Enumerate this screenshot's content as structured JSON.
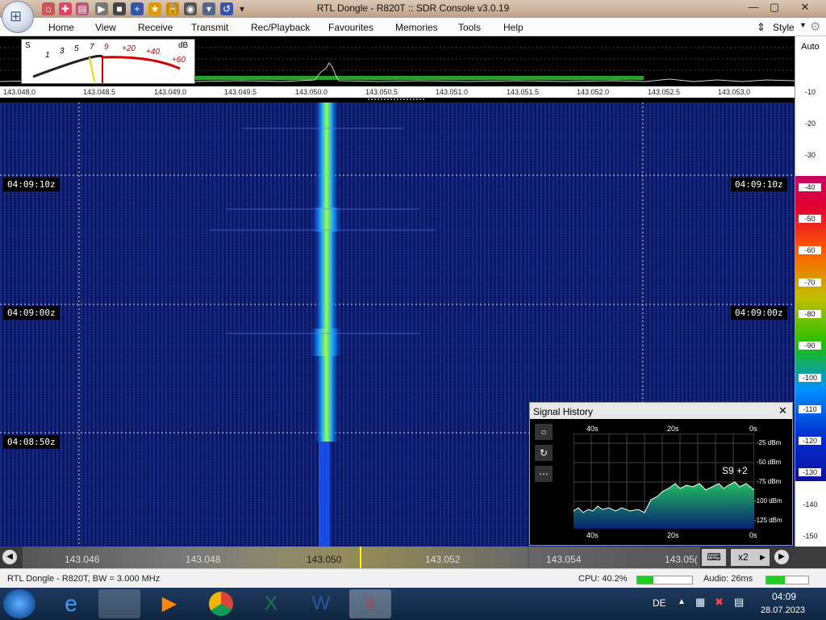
{
  "window": {
    "title": "RTL Dongle - R820T :: SDR Console v3.0.19"
  },
  "menu": {
    "items": [
      "Home",
      "View",
      "Receive",
      "Transmit",
      "Rec/Playback",
      "Favourites",
      "Memories",
      "Tools",
      "Help"
    ],
    "style_label": "Style"
  },
  "smeter": {
    "s_label": "S",
    "db_label": "dB",
    "s_ticks": [
      "1",
      "3",
      "5",
      "7",
      "9"
    ],
    "db_ticks": [
      "+20",
      "+40",
      "+60"
    ]
  },
  "spectrum": {
    "freq_ticks": [
      "143.048.0",
      "143.048.5",
      "143.049.0",
      "143.049.5",
      "143.050.0",
      "143.050.5",
      "143.051.0",
      "143.051.5",
      "143.052.0",
      "143.052.5",
      "143.053.0"
    ]
  },
  "waterfall": {
    "timestamps": [
      "04:09:10z",
      "04:09:00z",
      "04:08:50z"
    ]
  },
  "dbscale": {
    "auto_label": "Auto",
    "ticks": [
      "-10",
      "-20",
      "-30",
      "-40",
      "-50",
      "-60",
      "-70",
      "-80",
      "-90",
      "-100",
      "-110",
      "-120",
      "-130",
      "-140",
      "-150"
    ]
  },
  "signal_history": {
    "title": "Signal History",
    "x_ticks_top": [
      "40s",
      "20s",
      "0s"
    ],
    "x_ticks_bottom": [
      "40s",
      "20s",
      "0s"
    ],
    "y_ticks": [
      "-25 dBm",
      "-50 dBm",
      "-75 dBm",
      "-100 dBm",
      "-125 dBm"
    ],
    "readout": "S9 +2"
  },
  "tuner": {
    "freqs": [
      "143.046",
      "143.048",
      "143.050",
      "143.052",
      "143.054",
      "143.05("
    ],
    "zoom_label": "x2"
  },
  "status": {
    "device": "RTL Dongle - R820T, BW = 3.000 MHz",
    "cpu": "CPU: 40.2%",
    "audio": "Audio: 26ms"
  },
  "taskbar": {
    "lang": "DE",
    "time": "04:09",
    "date": "28.07.2023"
  }
}
